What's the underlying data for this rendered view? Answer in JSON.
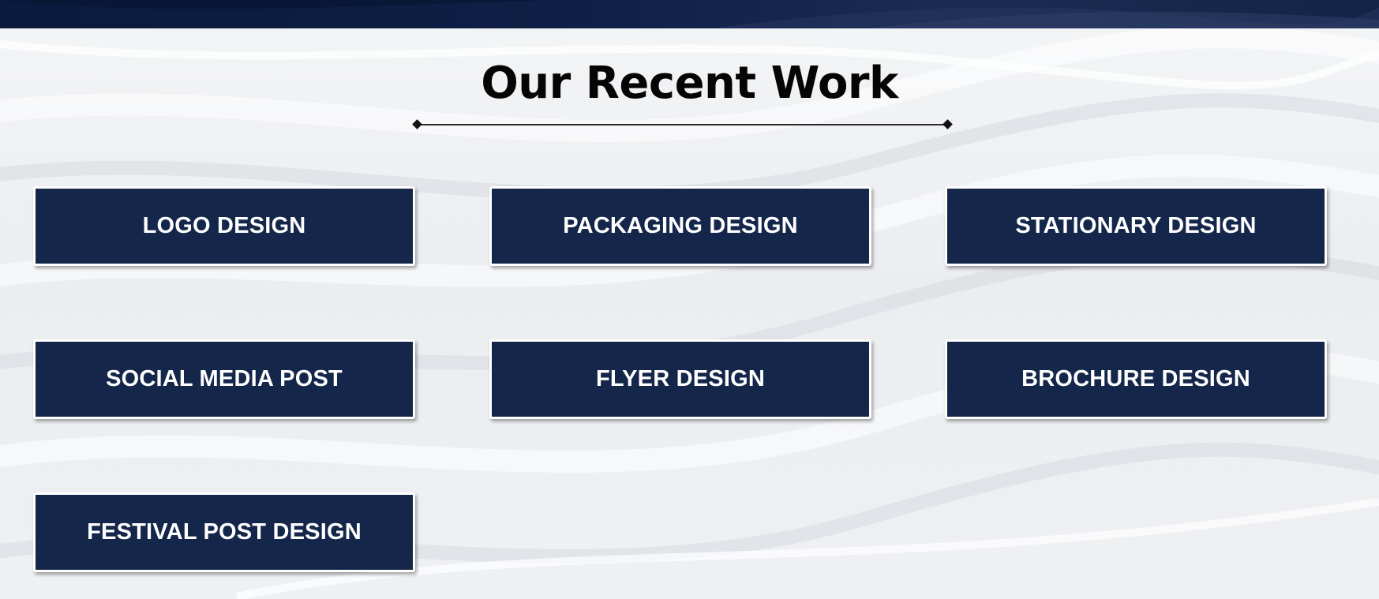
{
  "section": {
    "title": "Our Recent Work"
  },
  "work_categories": [
    {
      "label": "LOGO DESIGN"
    },
    {
      "label": "PACKAGING DESIGN"
    },
    {
      "label": "STATIONARY DESIGN"
    },
    {
      "label": "SOCIAL MEDIA POST"
    },
    {
      "label": "FLYER DESIGN"
    },
    {
      "label": "BROCHURE DESIGN"
    },
    {
      "label": "FESTIVAL POST DESIGN"
    }
  ],
  "colors": {
    "button_background": "#14264a",
    "button_border": "#ffffff",
    "button_text": "#ffffff",
    "title_text": "#050505",
    "header_band": "#0e1f45",
    "page_background": "#eceef1"
  }
}
